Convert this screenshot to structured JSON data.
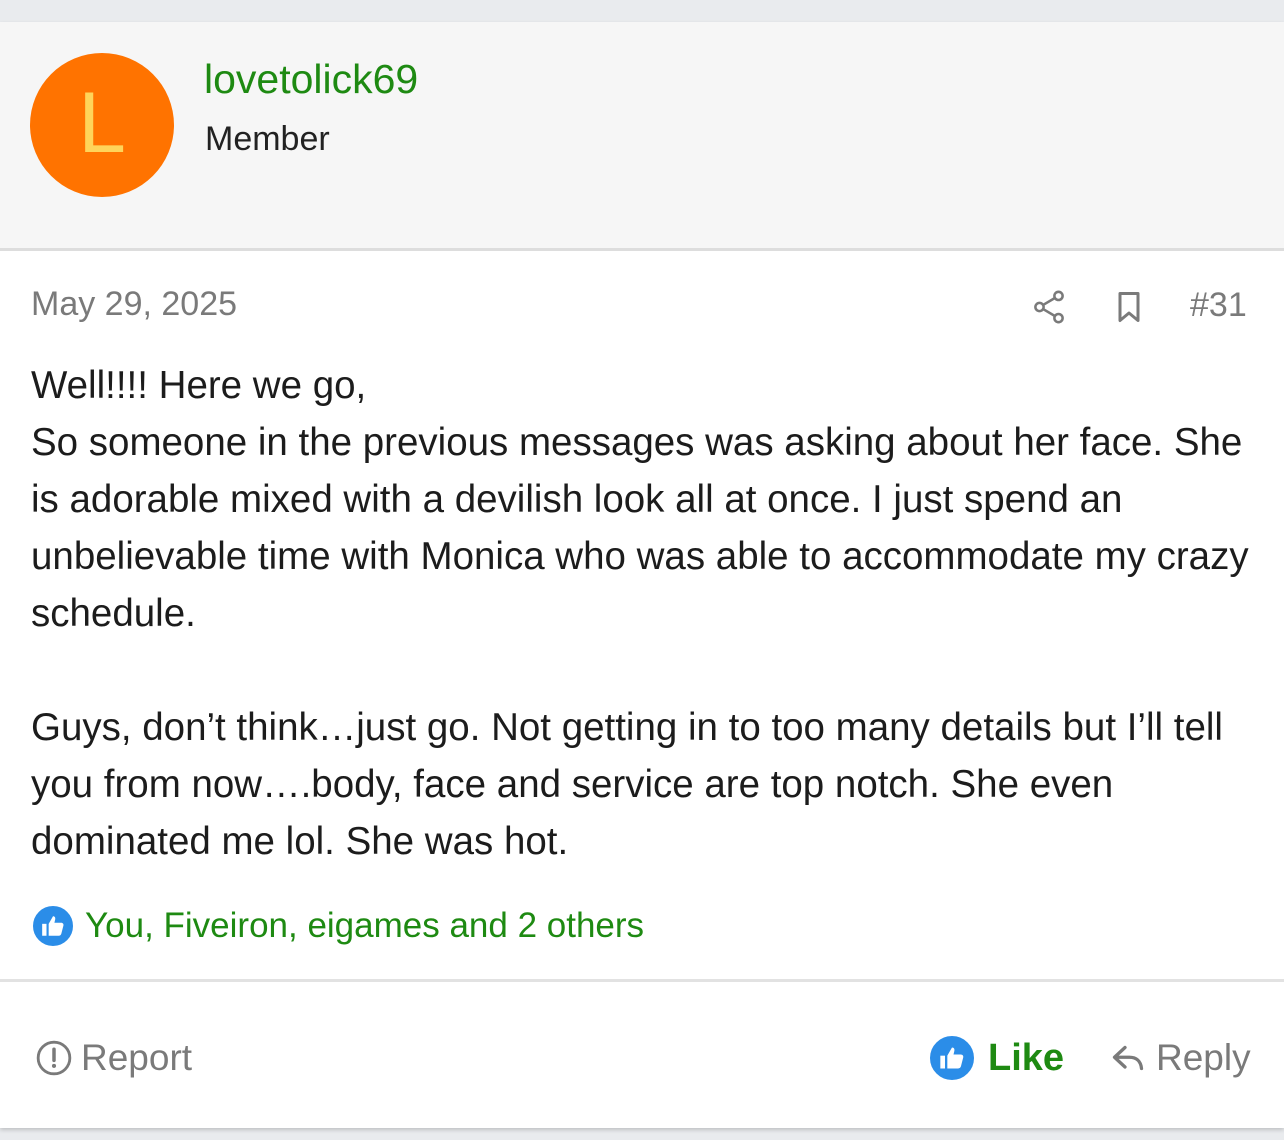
{
  "user": {
    "avatar_letter": "L",
    "avatar_color": "#ff7300",
    "avatar_letter_color": "#ffd45a",
    "username": "lovetolick69",
    "title": "Member"
  },
  "post": {
    "date": "May 29, 2025",
    "number": "#31",
    "icons": [
      "share-icon",
      "bookmark-icon"
    ],
    "paragraphs": [
      "Well!!!! Here we go,",
      "So someone in the previous messages was asking about her face. She is adorable mixed with a devilish look all at once. I just spend an unbelievable time with Monica who was able to accommodate my crazy schedule.",
      "Guys, don’t think…just go. Not getting in to too many details but I’ll tell you from now….body, face and service are top notch. She even dominated me lol. She was hot."
    ]
  },
  "reactions": {
    "icon": "thumbs-up-icon",
    "text": "You, Fiveiron, eigames and 2 others"
  },
  "actions": {
    "report_label": "Report",
    "like_label": "Like",
    "reply_label": "Reply"
  },
  "colors": {
    "link_green": "#1e8a12",
    "like_blue": "#2b8de8",
    "muted_gray": "#7a7a7a"
  }
}
